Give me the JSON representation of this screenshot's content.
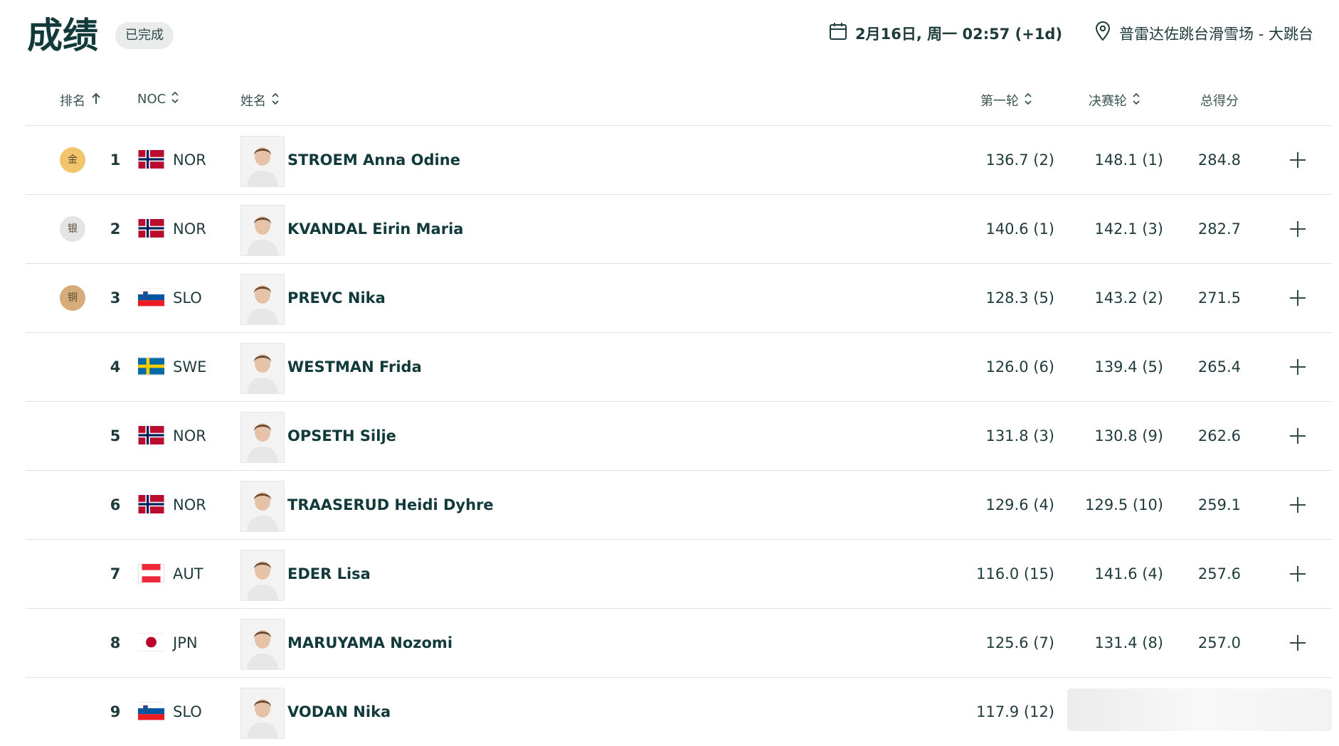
{
  "header": {
    "title": "成绩",
    "status": "已完成",
    "date": "2月16日, 周一 02:57 (+1d)",
    "venue": "普雷达佐跳台滑雪场 - 大跳台"
  },
  "columns": {
    "rank": "排名",
    "noc": "NOC",
    "name": "姓名",
    "round1": "第一轮",
    "final": "决赛轮",
    "total": "总得分"
  },
  "colors": {
    "gold": "#f2c46b",
    "silver": "#e4e4e4",
    "bronze": "#d6ad7a",
    "text": "#1f3a3a"
  },
  "rows": [
    {
      "medal": "金",
      "medal_type": "gold",
      "rank": "1",
      "noc": "NOR",
      "name": "STROEM Anna Odine",
      "round1": "136.7 (2)",
      "final": "148.1 (1)",
      "total": "284.8"
    },
    {
      "medal": "银",
      "medal_type": "silver",
      "rank": "2",
      "noc": "NOR",
      "name": "KVANDAL Eirin Maria",
      "round1": "140.6 (1)",
      "final": "142.1 (3)",
      "total": "282.7"
    },
    {
      "medal": "铜",
      "medal_type": "bronze",
      "rank": "3",
      "noc": "SLO",
      "name": "PREVC Nika",
      "round1": "128.3 (5)",
      "final": "143.2 (2)",
      "total": "271.5"
    },
    {
      "medal": "",
      "medal_type": "",
      "rank": "4",
      "noc": "SWE",
      "name": "WESTMAN Frida",
      "round1": "126.0 (6)",
      "final": "139.4 (5)",
      "total": "265.4"
    },
    {
      "medal": "",
      "medal_type": "",
      "rank": "5",
      "noc": "NOR",
      "name": "OPSETH Silje",
      "round1": "131.8 (3)",
      "final": "130.8 (9)",
      "total": "262.6"
    },
    {
      "medal": "",
      "medal_type": "",
      "rank": "6",
      "noc": "NOR",
      "name": "TRAASERUD Heidi Dyhre",
      "round1": "129.6 (4)",
      "final": "129.5 (10)",
      "total": "259.1"
    },
    {
      "medal": "",
      "medal_type": "",
      "rank": "7",
      "noc": "AUT",
      "name": "EDER Lisa",
      "round1": "116.0 (15)",
      "final": "141.6 (4)",
      "total": "257.6"
    },
    {
      "medal": "",
      "medal_type": "",
      "rank": "8",
      "noc": "JPN",
      "name": "MARUYAMA Nozomi",
      "round1": "125.6 (7)",
      "final": "131.4 (8)",
      "total": "257.0"
    },
    {
      "medal": "",
      "medal_type": "",
      "rank": "9",
      "noc": "SLO",
      "name": "VODAN Nika",
      "round1": "117.9 (12)",
      "final": "",
      "total": ""
    }
  ]
}
